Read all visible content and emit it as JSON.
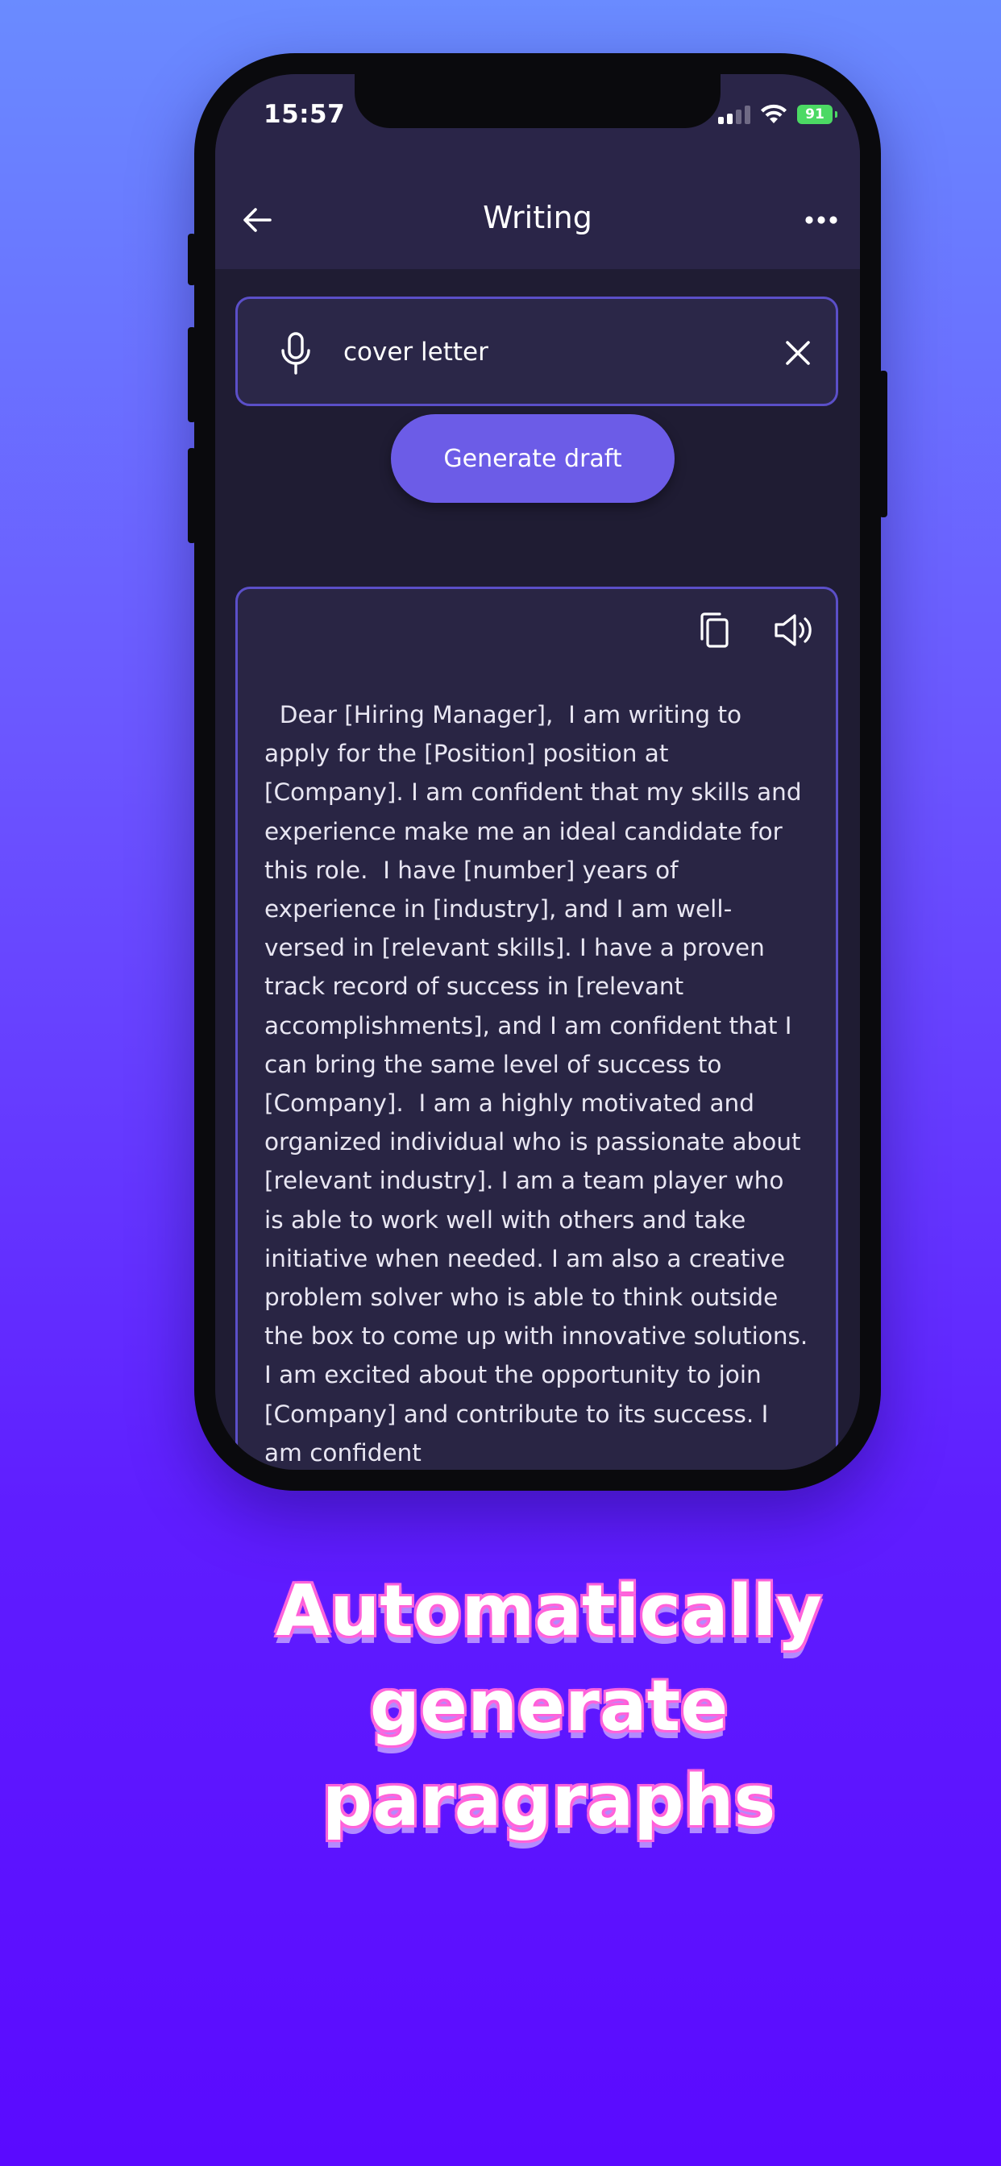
{
  "status_bar": {
    "time": "15:57",
    "battery": "91"
  },
  "nav": {
    "title": "Writing"
  },
  "input": {
    "value": "cover letter"
  },
  "actions": {
    "generate_label": "Generate draft"
  },
  "result": {
    "text": "  Dear [Hiring Manager],  I am writing to apply for the [Position] position at [Company]. I am confident that my skills and experience make me an ideal candidate for this role.  I have [number] years of experience in [industry], and I am well-versed in [relevant skills]. I have a proven track record of success in [relevant accomplishments], and I am confident that I can bring the same level of success to [Company].  I am a highly motivated and organized individual who is passionate about [relevant industry]. I am a team player who is able to work well with others and take initiative when needed. I am also a creative problem solver who is able to think outside the box to come up with innovative solutions.  I am excited about the opportunity to join [Company] and contribute to its success. I am confident"
  },
  "headline": {
    "line1": "Automatically generate",
    "line2": "paragraphs"
  },
  "colors": {
    "background_top": "#6a8bff",
    "background_bottom": "#5a0aff",
    "screen_bg": "#1f1c33",
    "bar_bg": "#2a2548",
    "accent": "#6c5ce7",
    "border": "#5b4fc8",
    "headline_glow": "#ff6ce0"
  },
  "icons": {
    "back": "arrow-left-icon",
    "more": "more-horizontal-icon",
    "mic": "microphone-icon",
    "clear": "close-icon",
    "copy": "copy-icon",
    "speaker": "speaker-icon"
  }
}
